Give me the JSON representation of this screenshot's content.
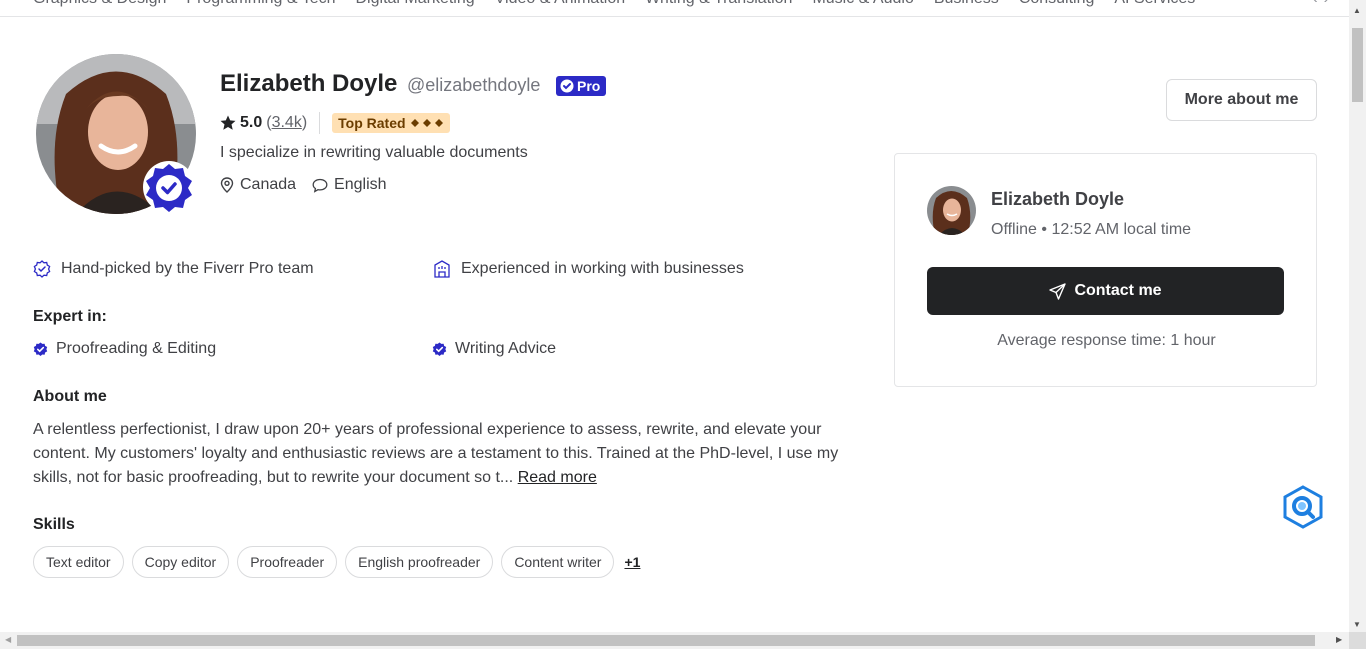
{
  "nav": {
    "categories": [
      "Graphics & Design",
      "Programming & Tech",
      "Digital Marketing",
      "Video & Animation",
      "Writing & Translation",
      "Music & Audio",
      "Business",
      "Consulting",
      "AI Services"
    ]
  },
  "profile": {
    "name": "Elizabeth Doyle",
    "handle": "@elizabethdoyle",
    "pro_label": "Pro",
    "rating": "5.0",
    "review_count": "3.4k",
    "top_rated_label": "Top Rated",
    "tagline": "I specialize in rewriting valuable documents",
    "country": "Canada",
    "language": "English"
  },
  "features": {
    "handpicked": "Hand-picked by the Fiverr Pro team",
    "business": "Experienced in working with businesses"
  },
  "expert": {
    "heading": "Expert in:",
    "items": [
      "Proofreading & Editing",
      "Writing Advice"
    ]
  },
  "about": {
    "heading": "About me",
    "text": "A relentless perfectionist, I draw upon 20+ years of professional experience to assess, rewrite, and elevate your content. My customers' loyalty and enthusiastic reviews are a testament to this. Trained at the PhD-level, I use my skills, not for basic proofreading, but to rewrite your document so t...",
    "read_more": "Read more"
  },
  "skills": {
    "heading": "Skills",
    "items": [
      "Text editor",
      "Copy editor",
      "Proofreader",
      "English proofreader",
      "Content writer"
    ],
    "more": "+1"
  },
  "actions": {
    "more_about": "More about me"
  },
  "contact": {
    "name": "Elizabeth Doyle",
    "status": "Offline • 12:52 AM local time",
    "button": "Contact me",
    "response": "Average response time: 1 hour"
  },
  "colors": {
    "pro_blue": "#2c2ac6",
    "top_rated_bg": "#ffe0b3",
    "dark_button": "#222325"
  }
}
